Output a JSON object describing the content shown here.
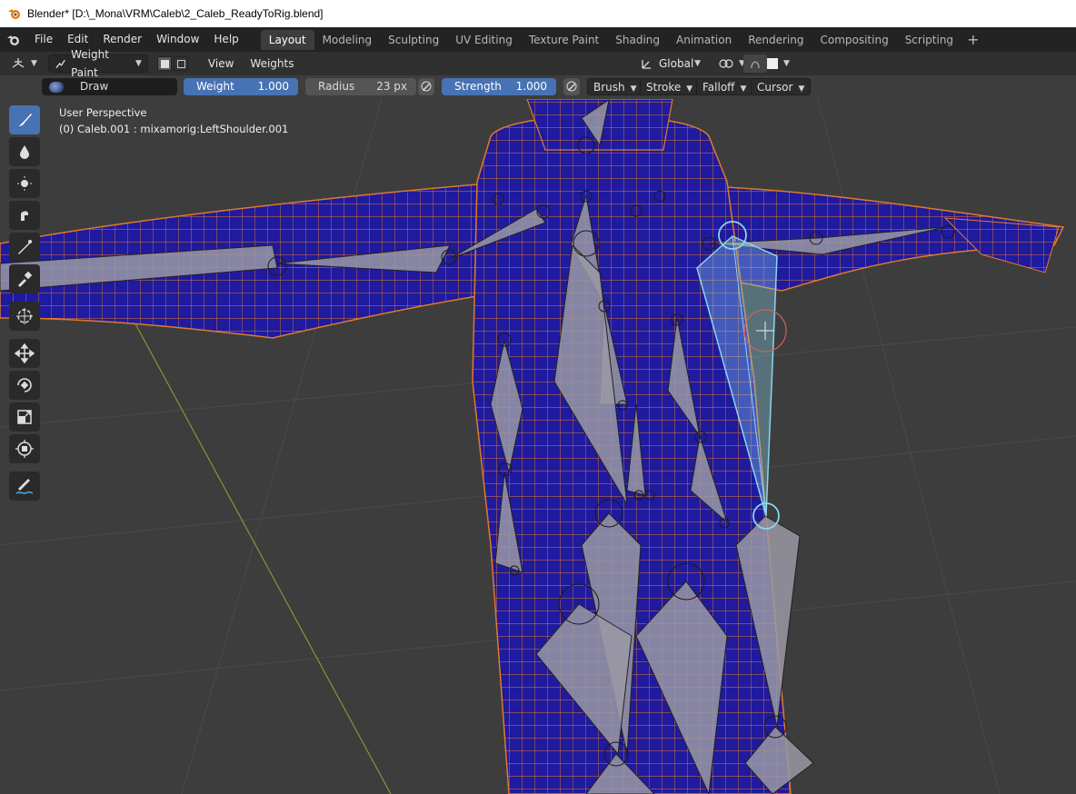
{
  "window": {
    "title": "Blender* [D:\\_Mona\\VRM\\Caleb\\2_Caleb_ReadyToRig.blend]"
  },
  "menu": {
    "items": [
      "File",
      "Edit",
      "Render",
      "Window",
      "Help"
    ],
    "workspaces": [
      "Layout",
      "Modeling",
      "Sculpting",
      "UV Editing",
      "Texture Paint",
      "Shading",
      "Animation",
      "Rendering",
      "Compositing",
      "Scripting"
    ],
    "active_workspace": "Layout",
    "add_workspace": "+"
  },
  "header": {
    "mode": "Weight Paint",
    "view_menu": "View",
    "weights_menu": "Weights",
    "orientation": "Global"
  },
  "tool_settings": {
    "brush_name": "Draw",
    "weight_label": "Weight",
    "weight_value": "1.000",
    "radius_label": "Radius",
    "radius_value": "23 px",
    "strength_label": "Strength",
    "strength_value": "1.000",
    "brush_menu": "Brush",
    "stroke_menu": "Stroke",
    "falloff_menu": "Falloff",
    "cursor_menu": "Cursor"
  },
  "viewport": {
    "perspective": "User Perspective",
    "object_info": "(0) Caleb.001 : mixamorig:LeftShoulder.001"
  },
  "toolbar": {
    "tools": [
      "draw-brush-icon",
      "blur-icon",
      "average-icon",
      "smear-icon",
      "gradient-icon",
      "sample-weight-icon",
      "cursor-icon",
      "move-icon",
      "rotate-icon",
      "scale-icon",
      "transform-icon",
      "annotate-icon"
    ]
  },
  "colors": {
    "accent": "#4772b3",
    "mesh_fill": "#1f1a9e",
    "wire": "#e07a2a",
    "selected_bone": "#8ad4ef"
  }
}
